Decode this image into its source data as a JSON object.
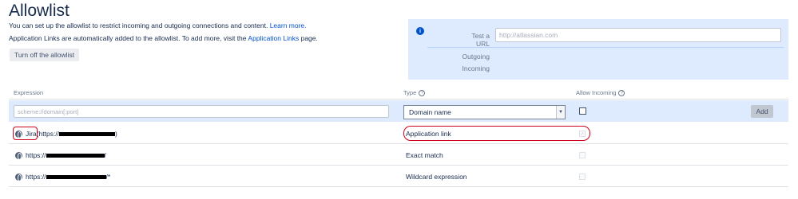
{
  "header": {
    "title": "Allowlist",
    "desc1_text": "You can set up the allowlist to restrict incoming and outgoing connections and content.",
    "desc1_link": "Learn more.",
    "desc2_text": "Application Links are automatically added to the allowlist. To add more, visit the",
    "desc2_link": "Application Links",
    "desc2_suffix": "page.",
    "toggle_button": "Turn off the allowlist"
  },
  "test_panel": {
    "info_icon": "info-icon",
    "url_label": "Test a URL",
    "url_placeholder": "http://atlassian.com",
    "outgoing_label": "Outgoing",
    "incoming_label": "Incoming"
  },
  "table": {
    "headers": {
      "expression": "Expression",
      "type": "Type",
      "allow_incoming": "Allow Incoming",
      "help_icon": "help-icon"
    },
    "add_row": {
      "expression_placeholder": "scheme://domain[:port]",
      "type_selected": "Domain name",
      "add_button": "Add"
    },
    "rows": [
      {
        "prefix": "Jira",
        "expression": "(https://",
        "suffix": ")",
        "type": "Application link",
        "allow_incoming": true
      },
      {
        "prefix": "",
        "expression": "https://",
        "suffix": "/",
        "type": "Exact match",
        "allow_incoming": false
      },
      {
        "prefix": "",
        "expression": "https://",
        "suffix": "/*",
        "type": "Wildcard expression",
        "allow_incoming": false
      }
    ]
  },
  "colors": {
    "accent": "#0052cc",
    "panel_bg": "#deebff",
    "annotation": "#d0021b"
  }
}
